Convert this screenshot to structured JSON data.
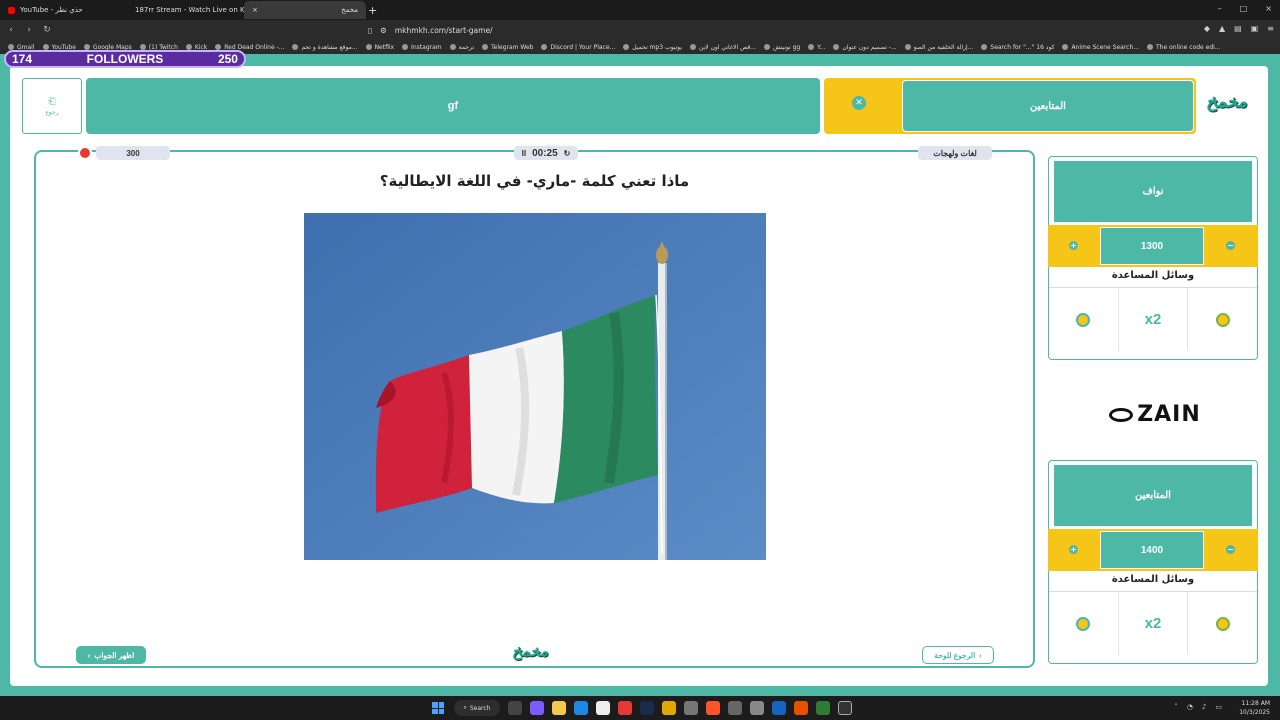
{
  "browser": {
    "tabs": [
      {
        "title": "YouTube - حذي نظر",
        "color": "#ff0000"
      },
      {
        "title": "187rr Stream - Watch Live on Kick",
        "color": "#53fc18"
      },
      {
        "title": "مخمخ",
        "color": "#4db8a6",
        "close": "×"
      }
    ],
    "new_tab": "+",
    "url": "mkhmkh.com/start-game/",
    "window_controls": [
      "–",
      "□",
      "×"
    ],
    "bookmarks": [
      "Gmail",
      "YouTube",
      "Google Maps",
      "(1) Twitch",
      "Kick",
      "Red Dead Online -...",
      "موقع مشاهدة و تحم...",
      "Netflix",
      "Instagram",
      "ترجمة",
      "Telegram Web",
      "Discord | Your Place...",
      "تحميل mp3 يوتيوب",
      "قص الاغاني اون لاين...",
      "تونيتش gg",
      "Y...",
      "تصميم دون عنوان -...",
      "إزالة الخلفية من الصو...",
      "Search for \"...\" 16 كود",
      "Anime Scene Search...",
      "The online code edi..."
    ]
  },
  "followers": {
    "left": "174",
    "label": "FOLLOWERS",
    "right": "250"
  },
  "game": {
    "back_label": "رجوع",
    "team_left": "gf",
    "team_right": "المتابعين",
    "logo": "مخمخ",
    "score_pill": "300",
    "timer": "00:25",
    "timer_pause": "II",
    "timer_reset": "↻",
    "category": "لغات ولهجات",
    "question": "ماذا تعني كلمة -ماري- في اللغة الايطالية؟",
    "show_answer": "اظهر الجواب",
    "back_to_board": "الرجوع للوحة"
  },
  "teams": [
    {
      "name": "نواف",
      "score": "1300",
      "help_title": "وسائل المساعدة",
      "x2": "x2"
    },
    {
      "name": "المتابعين",
      "score": "1400",
      "help_title": "وسائل المساعدة",
      "x2": "x2"
    }
  ],
  "sponsor": "ZAIN",
  "taskbar": {
    "search": "Search",
    "time": "11:28 AM",
    "date": "10/3/2025"
  },
  "colors": {
    "teal": "#4db8a6",
    "yellow": "#f5c518",
    "purple": "#5a2ca0"
  }
}
